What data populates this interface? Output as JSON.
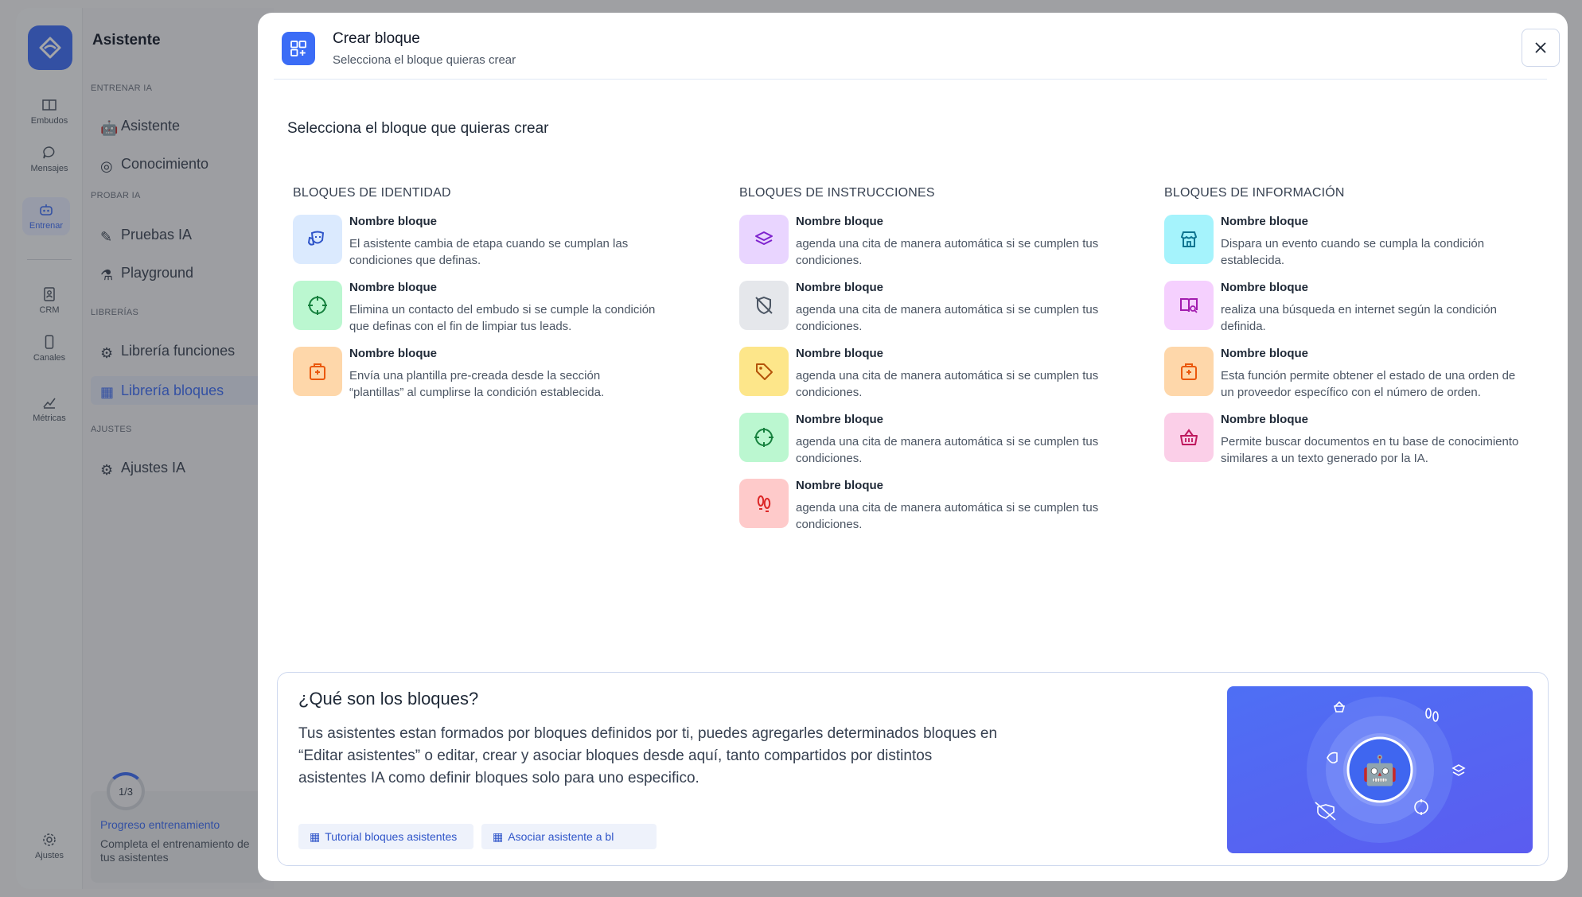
{
  "app": {
    "rail": [
      {
        "label": "Embudos",
        "icon": "columns-icon"
      },
      {
        "label": "Mensajes",
        "icon": "chat-icon"
      },
      {
        "label": "Entrenar",
        "icon": "robot-icon"
      },
      {
        "label": "CRM",
        "icon": "contact-card-icon"
      },
      {
        "label": "Canales",
        "icon": "phone-icon"
      },
      {
        "label": "Métricas",
        "icon": "chart-icon"
      },
      {
        "label": "Ajustes",
        "icon": "gear-icon"
      }
    ],
    "panel": {
      "title": "Asistente",
      "sections": [
        {
          "label": "ENTRENAR IA",
          "items": [
            "Asistente",
            "Conocimiento"
          ]
        },
        {
          "label": "PROBAR IA",
          "items": [
            "Pruebas IA",
            "Playground"
          ]
        },
        {
          "label": "LIBRERÍAS",
          "items": [
            "Librería funciones",
            "Librería bloques"
          ]
        },
        {
          "label": "AJUSTES",
          "items": [
            "Ajustes IA"
          ]
        }
      ],
      "progress": {
        "count": "1/3",
        "title": "Progreso entrenamiento",
        "desc": "Completa el entrenamiento de tus asistentes"
      }
    }
  },
  "modal": {
    "title": "Crear bloque",
    "subtitle": "Selecciona el bloque quieras crear",
    "section_title": "Selecciona el bloque que quieras crear",
    "columns": [
      {
        "heading": "BLOQUES DE IDENTIDAD",
        "items": [
          {
            "name": "Nombre bloque",
            "desc": "El asistente cambia de etapa cuando se cumplan las condiciones que definas.",
            "icon": "theater-masks-icon",
            "bg": "#dbeafe",
            "fg": "#2f55c9"
          },
          {
            "name": "Nombre bloque",
            "desc": "Elimina un contacto del embudo si se cumple la condición que definas con el fin de limpiar tus leads.",
            "icon": "crosshair-icon",
            "bg": "#bbf7d0",
            "fg": "#15803d"
          },
          {
            "name": "Nombre bloque",
            "desc": "Envía una plantilla pre-creada desde la sección “plantillas” al cumplirse la condición establecida.",
            "icon": "hospital-icon",
            "bg": "#fed7aa",
            "fg": "#ea580c"
          }
        ]
      },
      {
        "heading": "BLOQUES DE INSTRUCCIONES",
        "items": [
          {
            "name": "Nombre bloque",
            "desc": "agenda una cita de manera automática si se cumplen tus condiciones.",
            "icon": "layers-icon",
            "bg": "#e9d5ff",
            "fg": "#7e22ce"
          },
          {
            "name": "Nombre bloque",
            "desc": "agenda una cita de manera automática si se cumplen tus condiciones.",
            "icon": "shield-off-icon",
            "bg": "#e5e7eb",
            "fg": "#4b5563"
          },
          {
            "name": "Nombre bloque",
            "desc": "agenda una cita de manera automática si se cumplen tus condiciones.",
            "icon": "tag-icon",
            "bg": "#fde68a",
            "fg": "#b45309"
          },
          {
            "name": "Nombre bloque",
            "desc": "agenda una cita de manera automática si se cumplen tus condiciones.",
            "icon": "crosshair-icon",
            "bg": "#bbf7d0",
            "fg": "#15803d"
          },
          {
            "name": "Nombre bloque",
            "desc": "agenda una cita de manera automática si se cumplen tus condiciones.",
            "icon": "footprints-icon",
            "bg": "#fecaca",
            "fg": "#dc2626"
          }
        ]
      },
      {
        "heading": "BLOQUES DE INFORMACIÓN",
        "items": [
          {
            "name": "Nombre bloque",
            "desc": "Dispara un evento cuando se cumpla la condición establecida.",
            "icon": "store-icon",
            "bg": "#a5f3fc",
            "fg": "#0e7490"
          },
          {
            "name": "Nombre bloque",
            "desc": "realiza una búsqueda en internet según la condición definida.",
            "icon": "book-search-icon",
            "bg": "#f5d0fe",
            "fg": "#a21caf"
          },
          {
            "name": "Nombre bloque",
            "desc": "Esta función permite obtener el estado de una orden de un proveedor específico con el número de orden.",
            "icon": "hospital-icon",
            "bg": "#fed7aa",
            "fg": "#ea580c"
          },
          {
            "name": "Nombre bloque",
            "desc": "Permite buscar documentos en tu base de conocimiento similares a un texto generado por la IA.",
            "icon": "basket-icon",
            "bg": "#fbcfe8",
            "fg": "#be185d"
          }
        ]
      }
    ],
    "info": {
      "title": "¿Qué son los bloques?",
      "text": "Tus asistentes estan formados por bloques definidos por ti, puedes agregarles determinados bloques en “Editar asistentes” o editar, crear y asociar bloques desde aquí, tanto compartidos por distintos asistentes IA como definir bloques solo para uno especifico.",
      "links": [
        "Tutorial bloques asistentes",
        "Asociar asistente a bl"
      ]
    }
  }
}
